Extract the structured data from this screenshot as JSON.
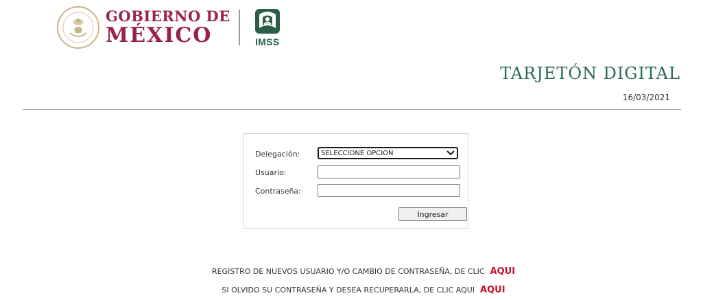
{
  "header": {
    "gob_line1": "GOBIERNO DE",
    "gob_line2": "MÉXICO",
    "imss_label": "IMSS"
  },
  "page": {
    "title": "TARJETÓN DIGITAL",
    "date": "16/03/2021"
  },
  "login": {
    "delegacion_label": "Delegación:",
    "delegacion_selected": "SELECCIONE OPCION",
    "usuario_label": "Usuario:",
    "usuario_value": "",
    "contrasena_label": "Contraseña:",
    "contrasena_value": "",
    "submit_label": "Ingresar"
  },
  "links": {
    "registro_text": "REGISTRO DE NUEVOS USUARIO Y/O CAMBIO DE CONTRASEÑA, DE CLIC",
    "registro_link": "AQUI",
    "recuperar_text": "SI OLVIDO SU CONTRASEÑA Y DESEA RECUPERARLA, DE CLIC AQUI",
    "recuperar_link": "AQUI"
  },
  "colors": {
    "gob_red": "#9b2247",
    "imss_green": "#2a5e45",
    "title_green": "#2a6b4d",
    "link_red": "#c8102e"
  },
  "icons": {
    "seal": "escudo-nacional-icon",
    "imss": "imss-logo-icon",
    "select_arrow": "chevron-down-icon"
  }
}
